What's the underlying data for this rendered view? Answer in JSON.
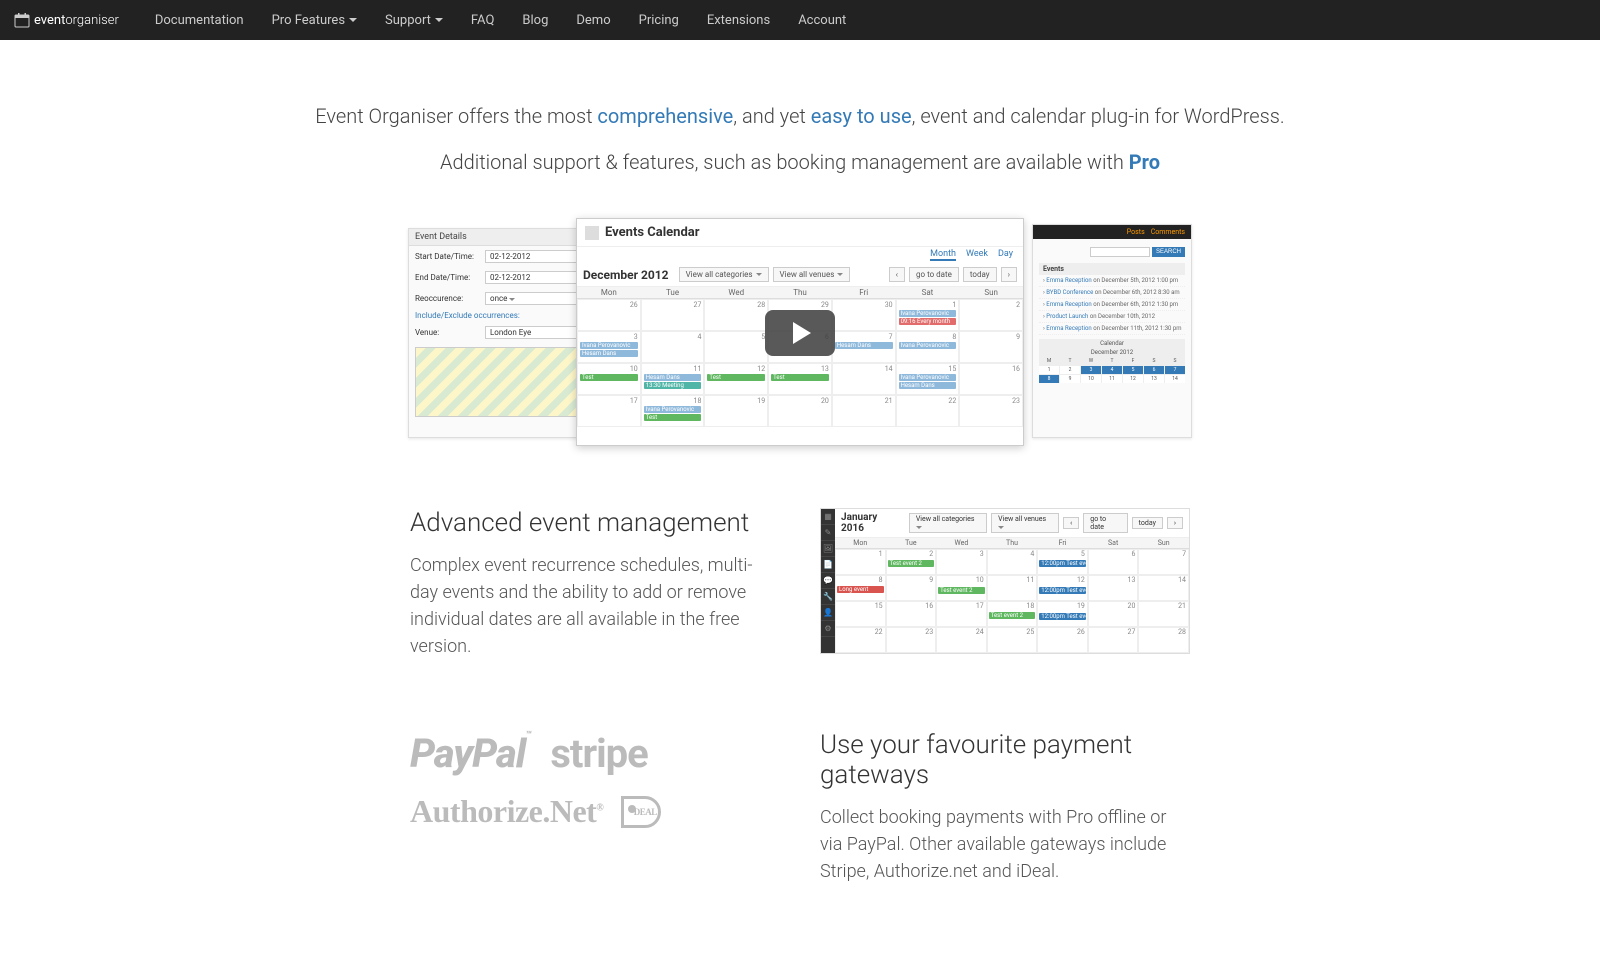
{
  "brand": {
    "first": "event",
    "second": "organiser"
  },
  "nav": {
    "documentation": "Documentation",
    "pro_features": "Pro Features",
    "support": "Support",
    "faq": "FAQ",
    "blog": "Blog",
    "demo": "Demo",
    "pricing": "Pricing",
    "extensions": "Extensions",
    "account": "Account"
  },
  "hero": {
    "line1_a": "Event Organiser offers the most ",
    "line1_link1": "comprehensive",
    "line1_b": ", and yet ",
    "line1_link2": "easy to use",
    "line1_c": ", event and calendar plug-in for WordPress.",
    "line2_a": "Additional support & features, such as booking management are available with ",
    "line2_link": "Pro"
  },
  "video": {
    "left": {
      "header": "Event Details",
      "start_lbl": "Start Date/Time:",
      "start_val": "02-12-2012",
      "end_lbl": "End Date/Time:",
      "end_val": "02-12-2012",
      "rec_lbl": "Reoccurence:",
      "rec_val": "once",
      "inc_link": "Include/Exclude occurrences:",
      "venue_lbl": "Venue:",
      "venue_val": "London Eye"
    },
    "center": {
      "title": "Events Calendar",
      "tabs": {
        "month": "Month",
        "week": "Week",
        "day": "Day"
      },
      "month": "December 2012",
      "btn_cat": "View all categories",
      "btn_ven": "View all venues",
      "btn_goto": "go to date",
      "btn_today": "today",
      "btn_prev": "‹",
      "btn_next": "›",
      "daynames": [
        "Mon",
        "Tue",
        "Wed",
        "Thu",
        "Fri",
        "Sat",
        "Sun"
      ],
      "cells": [
        {
          "n": "26"
        },
        {
          "n": "27"
        },
        {
          "n": "28"
        },
        {
          "n": "29"
        },
        {
          "n": "30"
        },
        {
          "n": "1",
          "evs": [
            {
              "cls": "blue",
              "t": "Ivana Perovanovic"
            },
            {
              "cls": "red",
              "t": "09:16 Every month"
            }
          ]
        },
        {
          "n": "2"
        },
        {
          "n": "3",
          "evs": [
            {
              "cls": "blue",
              "t": "Ivana Perovanovic"
            },
            {
              "cls": "blue",
              "t": "Hesam Dans"
            }
          ]
        },
        {
          "n": "4"
        },
        {
          "n": "5"
        },
        {
          "n": "6"
        },
        {
          "n": "7",
          "evs": [
            {
              "cls": "blue",
              "t": "Hesam Dans"
            }
          ]
        },
        {
          "n": "8",
          "evs": [
            {
              "cls": "blue",
              "t": "Ivana Perovanovic"
            }
          ]
        },
        {
          "n": "9"
        },
        {
          "n": "10",
          "evs": [
            {
              "cls": "green",
              "t": "Test"
            }
          ]
        },
        {
          "n": "11",
          "evs": [
            {
              "cls": "blue",
              "t": "Hesam Dans"
            },
            {
              "cls": "teal",
              "t": "13:30 Meeting"
            }
          ]
        },
        {
          "n": "12",
          "evs": [
            {
              "cls": "green",
              "t": "Test"
            }
          ]
        },
        {
          "n": "13",
          "evs": [
            {
              "cls": "green",
              "t": "Test"
            }
          ]
        },
        {
          "n": "14",
          "evs": [
            {
              "cls": "green",
              "t": ""
            }
          ]
        },
        {
          "n": "15",
          "evs": [
            {
              "cls": "blue",
              "t": "Ivana Perovanovic"
            },
            {
              "cls": "blue",
              "t": "Hesam Dans"
            }
          ]
        },
        {
          "n": "16"
        },
        {
          "n": "17"
        },
        {
          "n": "18",
          "evs": [
            {
              "cls": "blue",
              "t": "Ivana Perovanovic"
            },
            {
              "cls": "green",
              "t": "Test"
            }
          ]
        },
        {
          "n": "19"
        },
        {
          "n": "20"
        },
        {
          "n": "21"
        },
        {
          "n": "22"
        },
        {
          "n": "23"
        }
      ]
    },
    "right": {
      "feed": "Posts",
      "feed2": "Comments",
      "search_btn": "SEARCH",
      "events_header": "Events",
      "events": [
        {
          "t": "Emma Reception",
          "d": "on December 5th, 2012 1:00 pm"
        },
        {
          "t": "BYBD Conference",
          "d": "on December 6th, 2012 8:30 am"
        },
        {
          "t": "Emma Reception",
          "d": "on December 6th, 2012 1:30 pm"
        },
        {
          "t": "Product Launch",
          "d": "on December 10th, 2012"
        },
        {
          "t": "Emma Reception",
          "d": "on December 11th, 2012 1:30 pm"
        }
      ],
      "cal_label": "Calendar",
      "cal_month": "December 2012",
      "cal_days": [
        "M",
        "T",
        "W",
        "T",
        "F",
        "S",
        "S"
      ]
    }
  },
  "feature1": {
    "title": "Advanced event management",
    "body": "Complex event recurrence schedules, multi-day events and the ability to add or remove individual dates are all available in the free version.",
    "cal": {
      "month": "January 2016",
      "btn_cat": "View all categories",
      "btn_ven": "View all venues",
      "btn_goto": "go to date",
      "btn_today": "today",
      "btn_prev": "‹",
      "btn_next": "›",
      "daynames": [
        "Mon",
        "Tue",
        "Wed",
        "Thu",
        "Fri",
        "Sat",
        "Sun"
      ]
    }
  },
  "feature2": {
    "title": "Use your favourite payment gateways",
    "body": "Collect booking payments with Pro offline or via PayPal. Other available gateways include Stripe, Authorize.net and iDeal.",
    "logos": {
      "paypal": "PayPal",
      "stripe": "stripe",
      "anet": "Authorize.Net",
      "ideal": "DEAL"
    }
  }
}
